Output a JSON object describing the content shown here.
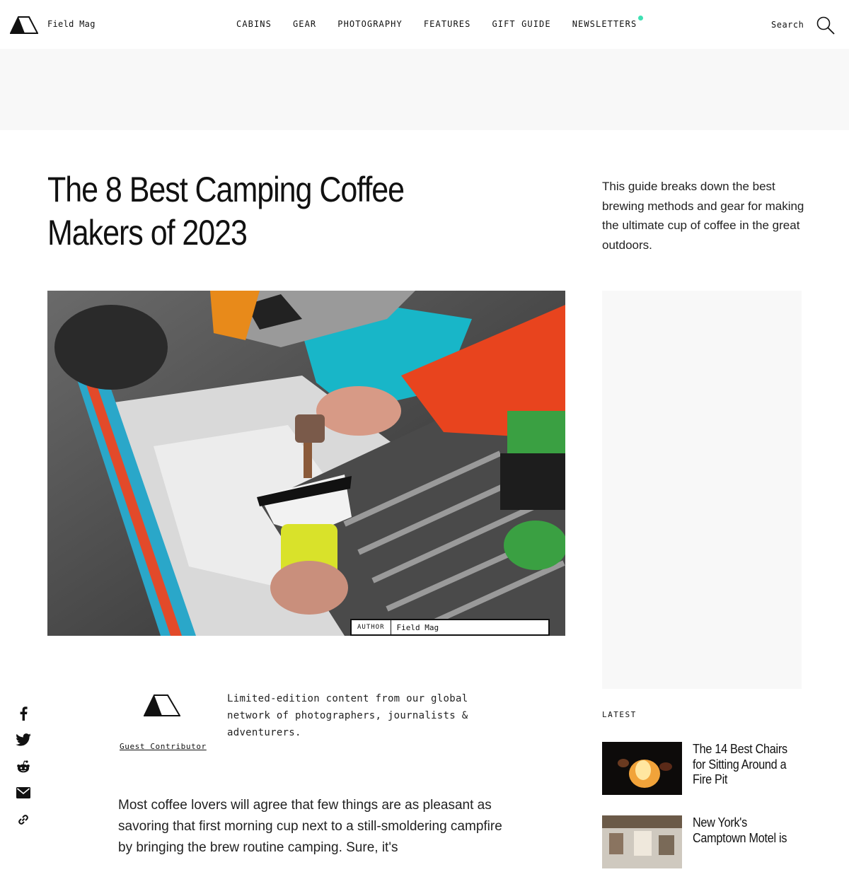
{
  "header": {
    "brand": "Field Mag",
    "nav": [
      "CABINS",
      "GEAR",
      "PHOTOGRAPHY",
      "FEATURES",
      "GIFT GUIDE",
      "NEWSLETTERS"
    ],
    "search_label": "Search",
    "accent_dot_color": "#3fe0b3"
  },
  "article": {
    "title_line1": "The 8 Best Camping Coffee",
    "title_line2": "Makers of 2023",
    "dek": "This guide breaks down the best brewing methods and gear for making the ultimate cup of coffee in the great outdoors.",
    "author_label": "AUTHOR",
    "author_name": "Field Mag",
    "contributor_link": "Guest Contributor",
    "contributor_desc": "Limited-edition content from our global network of photographers, journalists & adventurers.",
    "body": "Most coffee lovers will agree that few things are as pleasant as savoring that first morning cup next to a still-smoldering campfire by bringing the brew routine camping. Sure, it's"
  },
  "sidebar": {
    "latest_label": "LATEST",
    "items": [
      {
        "title": "The 14 Best Chairs for Sitting Around a Fire Pit"
      },
      {
        "title": "New York's Camptown Motel is"
      }
    ]
  },
  "share": [
    "facebook-icon",
    "twitter-icon",
    "reddit-icon",
    "email-icon",
    "link-icon"
  ]
}
